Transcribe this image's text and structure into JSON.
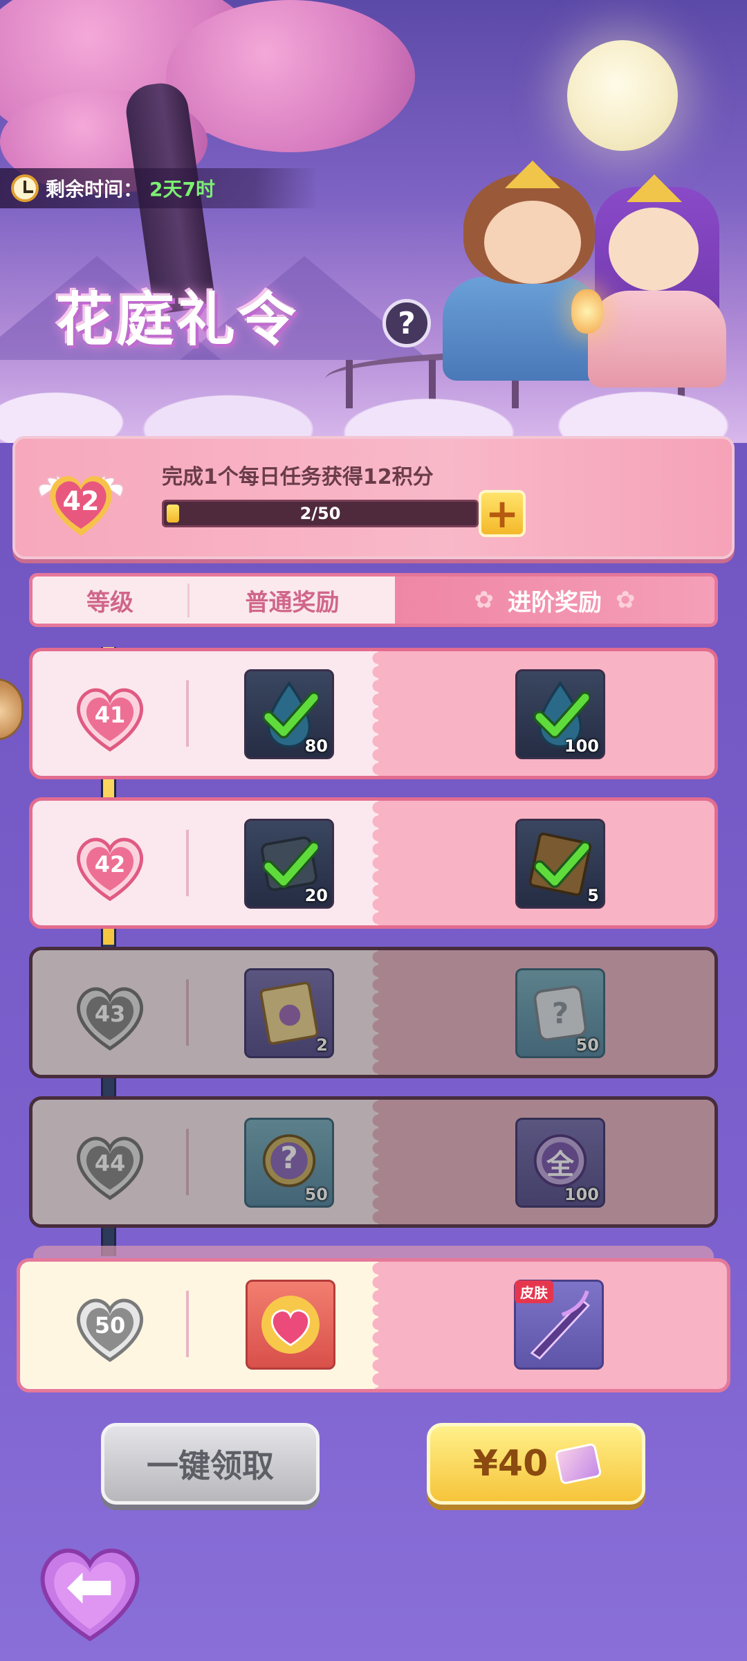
{
  "header": {
    "timer_label": "剩余时间：",
    "timer_value": "2天7时",
    "title": "花庭礼令",
    "help_symbol": "?"
  },
  "points": {
    "current_level": "42",
    "description": "完成1个每日任务获得12积分",
    "progress_text": "2/50",
    "progress_fraction": 0.04,
    "add_symbol": "+"
  },
  "columns": {
    "level": "等级",
    "normal": "普通奖励",
    "advanced": "进阶奖励"
  },
  "rows": [
    {
      "level": "41",
      "state": "claimed",
      "normal": {
        "icon": "water-drop-icon",
        "qty": "80",
        "claimed": true
      },
      "advanced": {
        "icon": "water-drop-icon",
        "qty": "100",
        "claimed": true
      }
    },
    {
      "level": "42",
      "state": "claimed",
      "normal": {
        "icon": "scroll-icon",
        "qty": "20",
        "claimed": true
      },
      "advanced": {
        "icon": "ticket-icon",
        "qty": "5",
        "claimed": true
      }
    },
    {
      "level": "43",
      "state": "locked",
      "normal": {
        "icon": "ticket-icon",
        "qty": "2"
      },
      "advanced": {
        "icon": "scroll-icon",
        "qty": "50"
      }
    },
    {
      "level": "44",
      "state": "locked",
      "normal": {
        "icon": "mystery-orb-icon",
        "qty": "50",
        "glyph": "?"
      },
      "advanced": {
        "icon": "coin-icon",
        "qty": "100",
        "glyph": "全"
      }
    },
    {
      "level": "50",
      "state": "final",
      "normal": {
        "icon": "heart-gem-icon",
        "qty": ""
      },
      "advanced": {
        "icon": "weapon-skin-icon",
        "qty": "",
        "badge": "皮肤"
      }
    }
  ],
  "buttons": {
    "claim_all": "一键领取",
    "buy": "¥40",
    "back_icon": "back-arrow-icon"
  },
  "colors": {
    "accent_pink": "#e36c8e",
    "gold": "#f4b82a",
    "background": "#7458c4",
    "claimed_check": "#5fdc3c"
  }
}
